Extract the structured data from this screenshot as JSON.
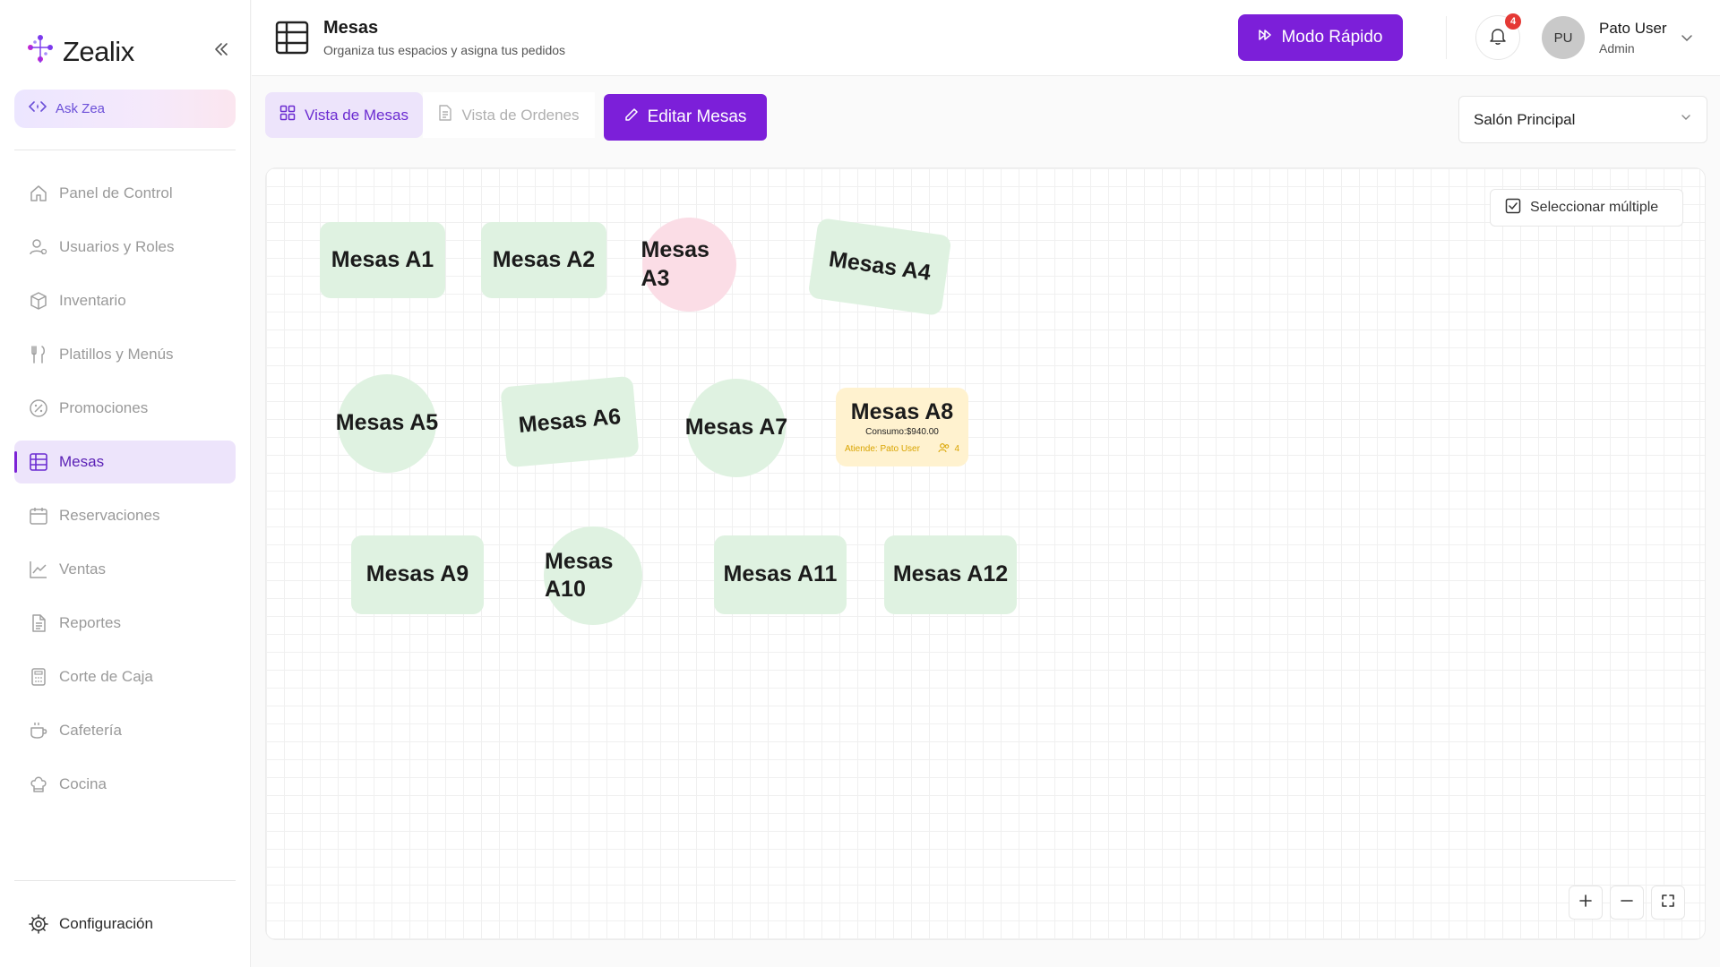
{
  "app": {
    "brand": "Zealix"
  },
  "sidebar": {
    "ask_label": "Ask Zea",
    "items": [
      {
        "label": "Panel de Control",
        "icon": "home-icon"
      },
      {
        "label": "Usuarios y Roles",
        "icon": "users-icon"
      },
      {
        "label": "Inventario",
        "icon": "package-icon"
      },
      {
        "label": "Platillos y Menús",
        "icon": "utensils-icon"
      },
      {
        "label": "Promociones",
        "icon": "discount-icon"
      },
      {
        "label": "Mesas",
        "icon": "table-grid-icon",
        "active": true
      },
      {
        "label": "Reservaciones",
        "icon": "calendar-icon"
      },
      {
        "label": "Ventas",
        "icon": "chart-line-icon"
      },
      {
        "label": "Reportes",
        "icon": "file-icon"
      },
      {
        "label": "Corte de Caja",
        "icon": "calculator-icon"
      },
      {
        "label": "Cafetería",
        "icon": "coffee-icon"
      },
      {
        "label": "Cocina",
        "icon": "chef-hat-icon"
      }
    ],
    "config_label": "Configuración"
  },
  "header": {
    "title": "Mesas",
    "subtitle": "Organiza tus espacios y asigna tus pedidos",
    "quick_mode_label": "Modo Rápido",
    "notifications_count": "4",
    "user": {
      "initials": "PU",
      "name": "Pato User",
      "role": "Admin"
    }
  },
  "toolbar": {
    "tab_tables": "Vista de Mesas",
    "tab_orders": "Vista de Ordenes",
    "edit_label": "Editar Mesas",
    "room_selected": "Salón Principal"
  },
  "canvas": {
    "multi_select_label": "Seleccionar múltiple",
    "tables": [
      {
        "name": "Mesas A1",
        "shape": "rect",
        "status": "free"
      },
      {
        "name": "Mesas A2",
        "shape": "rect",
        "status": "free"
      },
      {
        "name": "Mesas A3",
        "shape": "circle",
        "status": "reserved"
      },
      {
        "name": "Mesas A4",
        "shape": "rect",
        "status": "free"
      },
      {
        "name": "Mesas A5",
        "shape": "circle",
        "status": "free"
      },
      {
        "name": "Mesas A6",
        "shape": "rect",
        "status": "free"
      },
      {
        "name": "Mesas A7",
        "shape": "circle",
        "status": "free"
      },
      {
        "name": "Mesas A8",
        "shape": "rect",
        "status": "occupied",
        "consumo": "Consumo:$940.00",
        "attendant": "Atiende: Pato User",
        "guests": "4"
      },
      {
        "name": "Mesas A9",
        "shape": "rect",
        "status": "free"
      },
      {
        "name": "Mesas A10",
        "shape": "circle",
        "status": "free"
      },
      {
        "name": "Mesas A11",
        "shape": "rect",
        "status": "free"
      },
      {
        "name": "Mesas A12",
        "shape": "rect",
        "status": "free"
      }
    ]
  },
  "colors": {
    "accent": "#7c1fd9",
    "active_nav_bg": "#ede4fb",
    "table_free": "#dff2e1",
    "table_reserved": "#fbdde6",
    "table_occupied": "#fff2cf",
    "badge": "#e53935"
  }
}
